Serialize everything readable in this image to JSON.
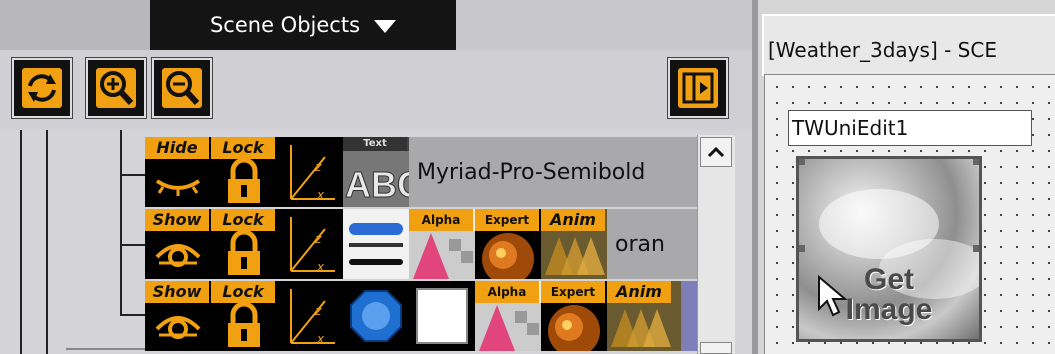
{
  "scene_panel": {
    "title": "Scene Objects",
    "toolbar": {
      "refresh_icon": "refresh-icon",
      "zoom_in_icon": "zoom-in-icon",
      "zoom_out_icon": "zoom-out-icon",
      "panel_toggle_icon": "panel-toggle-icon"
    },
    "rows": [
      {
        "visibility": "Hide",
        "lock": "Lock",
        "type_tag": "Text",
        "label": "Myriad-Pro-Semibold",
        "selected": false
      },
      {
        "visibility": "Show",
        "lock": "Lock",
        "alpha": "Alpha",
        "expert": "Expert",
        "anim": "Anim",
        "label": "oran",
        "selected": false
      },
      {
        "visibility": "Show",
        "lock": "Lock",
        "alpha": "Alpha",
        "expert": "Expert",
        "anim": "Anim",
        "label": "",
        "selected": true
      }
    ]
  },
  "designer": {
    "window_title": "[Weather_3days] - SCE",
    "edit_text": "TWUniEdit1",
    "image_button_text": "Get\nImage"
  },
  "colors": {
    "tag_orange": "#f0a010",
    "selected_row": "#7d7db8",
    "title_bar": "#141414"
  }
}
